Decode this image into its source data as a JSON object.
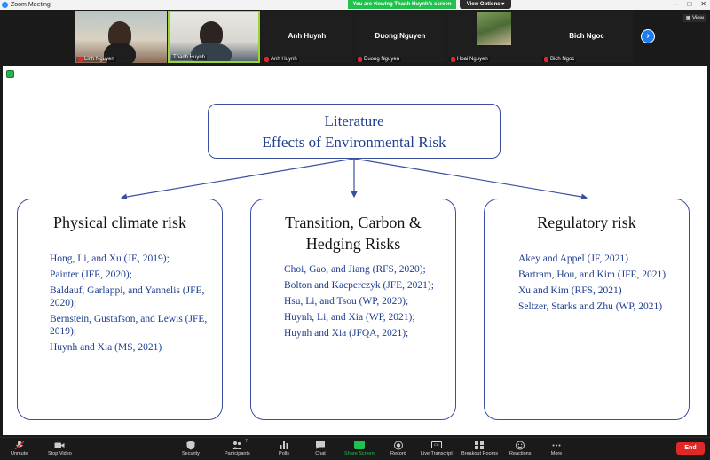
{
  "window": {
    "title": "Zoom Meeting"
  },
  "banner": {
    "sharing": "You are viewing Thanh Huynh's screen",
    "view_options": "View Options"
  },
  "strip": {
    "view_label": "View",
    "participants": [
      {
        "name": "Linh Nguyen",
        "type": "video"
      },
      {
        "name": "Thanh Huynh",
        "type": "video"
      },
      {
        "name": "Anh Huynh",
        "type": "name"
      },
      {
        "name": "Duong Nguyen",
        "type": "name"
      },
      {
        "name": "Hoai Nguyen",
        "type": "photo"
      },
      {
        "name": "Bich Ngoc",
        "type": "name"
      }
    ]
  },
  "slide": {
    "title_line1": "Literature",
    "title_line2": "Effects of Environmental Risk",
    "columns": [
      {
        "title": "Physical climate risk",
        "refs": [
          "Hong, Li, and Xu (JE, 2019);",
          "Painter (JFE, 2020);",
          "Baldauf, Garlappi, and Yannelis (JFE, 2020);",
          "Bernstein, Gustafson, and Lewis (JFE, 2019);",
          "Huynh and Xia (MS, 2021)"
        ]
      },
      {
        "title": "Transition, Carbon & Hedging Risks",
        "refs": [
          "Choi, Gao, and Jiang (RFS, 2020);",
          "Bolton and Kacperczyk (JFE, 2021);",
          "Hsu, Li, and Tsou (WP, 2020);",
          "Huynh, Li, and Xia (WP, 2021);",
          "Huynh and Xia (JFQA, 2021);"
        ]
      },
      {
        "title": "Regulatory risk",
        "refs": [
          "Akey and Appel (JF, 2021)",
          "Bartram, Hou, and Kim (JFE, 2021)",
          "Xu and Kim (RFS, 2021)",
          "Seltzer, Starks and Zhu (WP, 2021)"
        ]
      }
    ]
  },
  "toolbar": {
    "unmute": "Unmute",
    "stop_video": "Stop Video",
    "security": "Security",
    "participants": "Participants",
    "participants_count": "7",
    "polls": "Polls",
    "chat": "Chat",
    "share_screen": "Share Screen",
    "record": "Record",
    "live_transcript": "Live Transcript",
    "cc": "CC",
    "breakout_rooms": "Breakout Rooms",
    "reactions": "Reactions",
    "more": "More",
    "end": "End"
  },
  "colors": {
    "share_green": "#20c14c",
    "end_red": "#e02828",
    "slide_blue": "#1e3d8f",
    "accent_blue": "#1d7cf2"
  }
}
